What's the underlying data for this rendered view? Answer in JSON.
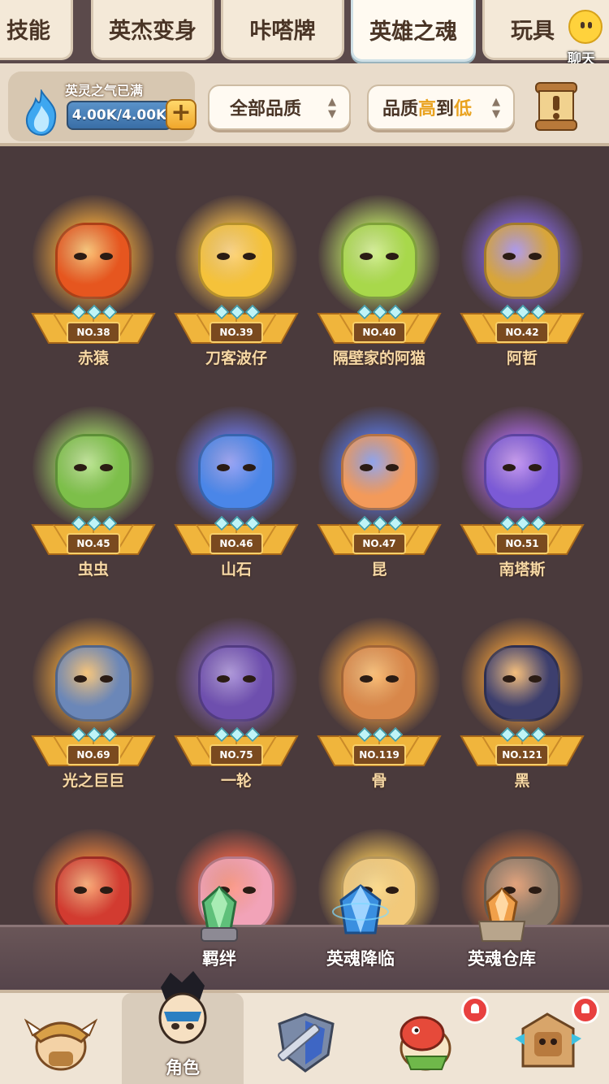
{
  "tabs": [
    {
      "label": "技能"
    },
    {
      "label": "英杰变身"
    },
    {
      "label": "咔嗒牌"
    },
    {
      "label": "英雄之魂"
    },
    {
      "label": "玩具"
    }
  ],
  "chat": {
    "label": "聊天"
  },
  "energy": {
    "title": "英灵之气已满",
    "value": "4.00K/4.00K",
    "plus": "+"
  },
  "filters": {
    "quality": "全部品质",
    "sort_prefix": "品质",
    "sort_high": "高",
    "sort_mid": "到",
    "sort_low": "低"
  },
  "souls": [
    {
      "num": "NO.38",
      "name": "赤猿",
      "color": "#e6561f",
      "aura": "#ffb13b"
    },
    {
      "num": "NO.39",
      "name": "刀客波仔",
      "color": "#f5c23a",
      "aura": "#ffc44d"
    },
    {
      "num": "NO.40",
      "name": "隔壁家的阿猫",
      "color": "#a8d84b",
      "aura": "#c7f06a"
    },
    {
      "num": "NO.42",
      "name": "阿哲",
      "color": "#d8a53a",
      "aura": "#8a6cf0"
    },
    {
      "num": "NO.45",
      "name": "虫虫",
      "color": "#7dbf4a",
      "aura": "#a6e06a"
    },
    {
      "num": "NO.46",
      "name": "山石",
      "color": "#4a86e8",
      "aura": "#6f7cf5"
    },
    {
      "num": "NO.47",
      "name": "昆",
      "color": "#f39a5a",
      "aura": "#5a7cf0"
    },
    {
      "num": "NO.51",
      "name": "南塔斯",
      "color": "#7b5ad6",
      "aura": "#b16cf0"
    },
    {
      "num": "NO.69",
      "name": "光之巨巨",
      "color": "#6b87b8",
      "aura": "#ffb13b"
    },
    {
      "num": "NO.75",
      "name": "一轮",
      "color": "#6e4fae",
      "aura": "#8d6cd0"
    },
    {
      "num": "NO.119",
      "name": "骨",
      "color": "#d8874a",
      "aura": "#ffa83b"
    },
    {
      "num": "NO.121",
      "name": "黑",
      "color": "#3d3f6e",
      "aura": "#ffa83b"
    },
    {
      "num": "",
      "name": "",
      "color": "#d23b30",
      "aura": "#ff8a3b"
    },
    {
      "num": "",
      "name": "",
      "color": "#f2a3b8",
      "aura": "#ff6a4b"
    },
    {
      "num": "",
      "name": "",
      "color": "#f2c97a",
      "aura": "#ffcf5b"
    },
    {
      "num": "",
      "name": "",
      "color": "#8a7a6a",
      "aura": "#e07a3b"
    }
  ],
  "subactions": [
    {
      "label": "羁绊"
    },
    {
      "label": "英魂降临"
    },
    {
      "label": "英魂仓库"
    }
  ],
  "nav": [
    {
      "label": ""
    },
    {
      "label": "角色"
    },
    {
      "label": ""
    },
    {
      "label": ""
    },
    {
      "label": ""
    }
  ]
}
